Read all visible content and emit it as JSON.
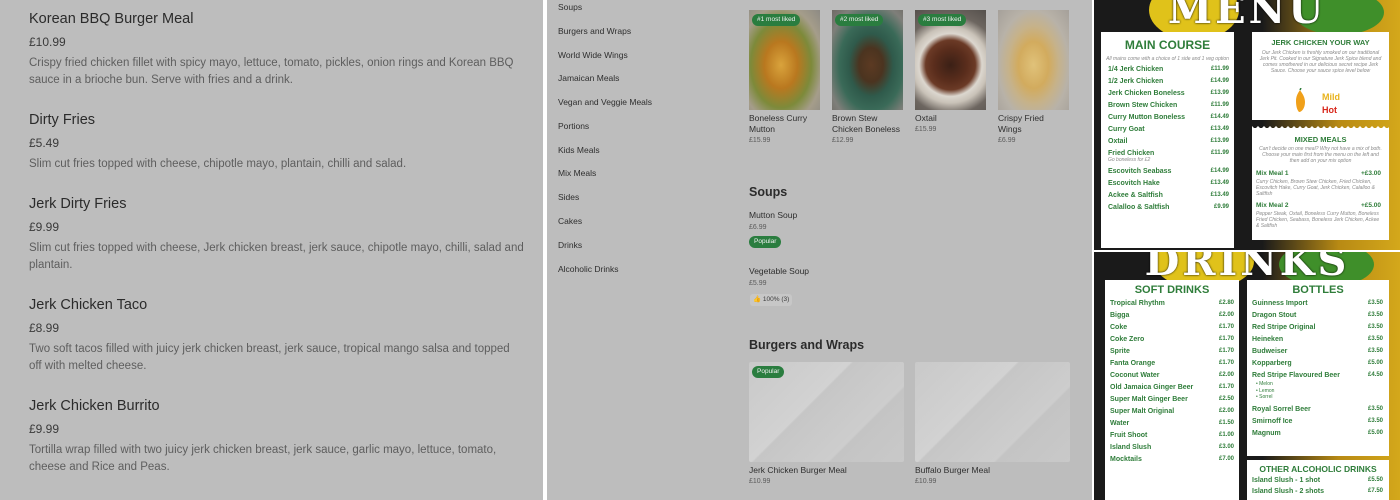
{
  "panel_a": {
    "items": [
      {
        "name": "Korean BBQ Burger Meal",
        "price": "£10.99",
        "desc": "Crispy fried chicken fillet with spicy mayo, lettuce, tomato, pickles, onion rings and Korean BBQ sauce in a brioche bun. Serve with fries and a drink."
      },
      {
        "name": "Dirty Fries",
        "price": "£5.49",
        "desc": "Slim cut fries topped with cheese, chipotle mayo, plantain, chilli and salad."
      },
      {
        "name": "Jerk Dirty Fries",
        "price": "£9.99",
        "desc": "Slim cut fries topped with cheese, Jerk chicken breast, jerk sauce, chipotle mayo, chilli, salad and plantain."
      },
      {
        "name": "Jerk Chicken Taco",
        "price": "£8.99",
        "desc": "Two soft tacos filled with juicy jerk chicken breast, jerk sauce, tropical mango salsa and topped off with melted cheese."
      },
      {
        "name": "Jerk Chicken Burrito",
        "price": "£9.99",
        "desc": "Tortilla wrap filled with two juicy jerk chicken breast, jerk sauce, garlic mayo, lettuce, tomato, cheese and Rice and Peas."
      }
    ]
  },
  "panel_b": {
    "categories": [
      "Soups",
      "Burgers and Wraps",
      "World Wide Wings",
      "Jamaican Meals",
      "Vegan and Veggie Meals",
      "Portions",
      "Kids Meals",
      "Mix Meals",
      "Sides",
      "Cakes",
      "Drinks",
      "Alcoholic Drinks"
    ],
    "top_items": [
      {
        "badge": "#1 most liked",
        "name": "Boneless Curry Mutton",
        "price": "£15.99"
      },
      {
        "badge": "#2 most liked",
        "name": "Brown Stew Chicken Boneless",
        "price": "£12.99"
      },
      {
        "badge": "#3 most liked",
        "name": "Oxtail",
        "price": "£15.99"
      },
      {
        "badge": "",
        "name": "Crispy Fried Wings",
        "price": "£6.99"
      }
    ],
    "soups": {
      "title": "Soups",
      "items": [
        {
          "name": "Mutton Soup",
          "price": "£6.99",
          "tag": "Popular"
        },
        {
          "name": "Vegetable Soup",
          "price": "£5.99",
          "rating": "100% (3)"
        }
      ]
    },
    "burgers": {
      "title": "Burgers and Wraps",
      "items": [
        {
          "name": "Jerk Chicken Burger Meal",
          "price": "£10.99",
          "tag": "Popular"
        },
        {
          "name": "Buffalo Burger Meal",
          "price": "£10.99"
        }
      ]
    }
  },
  "panel_c": {
    "title": "MENU",
    "main_course": {
      "heading": "MAIN COURSE",
      "note": "All mains come with a choice of 1 side and 1 veg option",
      "items": [
        {
          "name": "1/4 Jerk Chicken",
          "price": "£11.99"
        },
        {
          "name": "1/2 Jerk Chicken",
          "price": "£14.99"
        },
        {
          "name": "Jerk Chicken Boneless",
          "price": "£13.99"
        },
        {
          "name": "Brown Stew Chicken",
          "price": "£11.99"
        },
        {
          "name": "Curry Mutton Boneless",
          "price": "£14.49"
        },
        {
          "name": "Curry Goat",
          "price": "£13.49"
        },
        {
          "name": "Oxtail",
          "price": "£13.99"
        },
        {
          "name": "Fried Chicken",
          "price": "£11.99",
          "note": "Go boneless for £2"
        },
        {
          "name": "Escovitch Seabass",
          "price": "£14.99"
        },
        {
          "name": "Escovitch Hake",
          "price": "£13.49"
        },
        {
          "name": "Ackee & Saltfish",
          "price": "£13.49"
        },
        {
          "name": "Calalloo & Saltfish",
          "price": "£9.99"
        }
      ]
    },
    "jerk_way": {
      "heading": "JERK CHICKEN YOUR WAY",
      "desc": "Our Jerk Chicken is freshly smoked on our traditional Jerk Pit. Cooked in our Signature Jerk Spice blend and comes smothered in our delicious secret recipe Jerk Sauce. Choose your sauce spice level below",
      "mild": "Mild",
      "hot": "Hot"
    },
    "mixed": {
      "heading": "MIXED MEALS",
      "desc": "Can't decide on one meal? Why not have a mix of both. Choose your main first from the menu on the left and then add on your mix option",
      "items": [
        {
          "name": "Mix Meal 1",
          "price": "+£3.00",
          "desc": "Curry Chicken, Brown Stew Chicken, Fried Chicken, Escovitch Hake, Curry Goat, Jerk Chicken, Calalloo & Saltfish"
        },
        {
          "name": "Mix Meal 2",
          "price": "+£5.00",
          "desc": "Pepper Steak, Oxtail, Boneless Curry Mutton, Boneless Fried Chicken, Seabass, Boneless Jerk Chicken, Ackee & Saltfish"
        }
      ]
    }
  },
  "panel_d": {
    "title": "DRINKS",
    "soft": {
      "heading": "SOFT DRINKS",
      "items": [
        {
          "name": "Tropical Rhythm",
          "price": "£2.80"
        },
        {
          "name": "Bigga",
          "price": "£2.00"
        },
        {
          "name": "Coke",
          "price": "£1.70"
        },
        {
          "name": "Coke Zero",
          "price": "£1.70"
        },
        {
          "name": "Sprite",
          "price": "£1.70"
        },
        {
          "name": "Fanta Orange",
          "price": "£1.70"
        },
        {
          "name": "Coconut Water",
          "price": "£2.00"
        },
        {
          "name": "Old Jamaica Ginger Beer",
          "price": "£1.70"
        },
        {
          "name": "Super Malt Ginger Beer",
          "price": "£2.50"
        },
        {
          "name": "Super Malt Original",
          "price": "£2.00"
        },
        {
          "name": "Water",
          "price": "£1.50"
        },
        {
          "name": "Fruit Shoot",
          "price": "£1.00"
        },
        {
          "name": "Island Slush",
          "price": "£3.00"
        },
        {
          "name": "Mocktails",
          "price": "£7.00"
        }
      ]
    },
    "bottles": {
      "heading": "BOTTLES",
      "items": [
        {
          "name": "Guinness Import",
          "price": "£3.50"
        },
        {
          "name": "Dragon Stout",
          "price": "£3.50"
        },
        {
          "name": "Red Stripe Original",
          "price": "£3.50"
        },
        {
          "name": "Heineken",
          "price": "£3.50"
        },
        {
          "name": "Budweiser",
          "price": "£3.50"
        },
        {
          "name": "Kopparberg",
          "price": "£5.00"
        },
        {
          "name": "Red Stripe Flavoured Beer",
          "price": "£4.50"
        },
        {
          "name": "Royal Sorrel Beer",
          "price": "£3.50"
        },
        {
          "name": "Smirnoff Ice",
          "price": "£3.50"
        },
        {
          "name": "Magnum",
          "price": "£5.00"
        }
      ],
      "flavours": [
        "• Melon",
        "• Lemon",
        "• Sorrel"
      ]
    },
    "other": {
      "heading": "OTHER ALCOHOLIC DRINKS",
      "items": [
        {
          "name": "Island Slush - 1 shot",
          "price": "£5.50"
        },
        {
          "name": "Island Slush - 2 shots",
          "price": "£7.50"
        }
      ]
    }
  }
}
